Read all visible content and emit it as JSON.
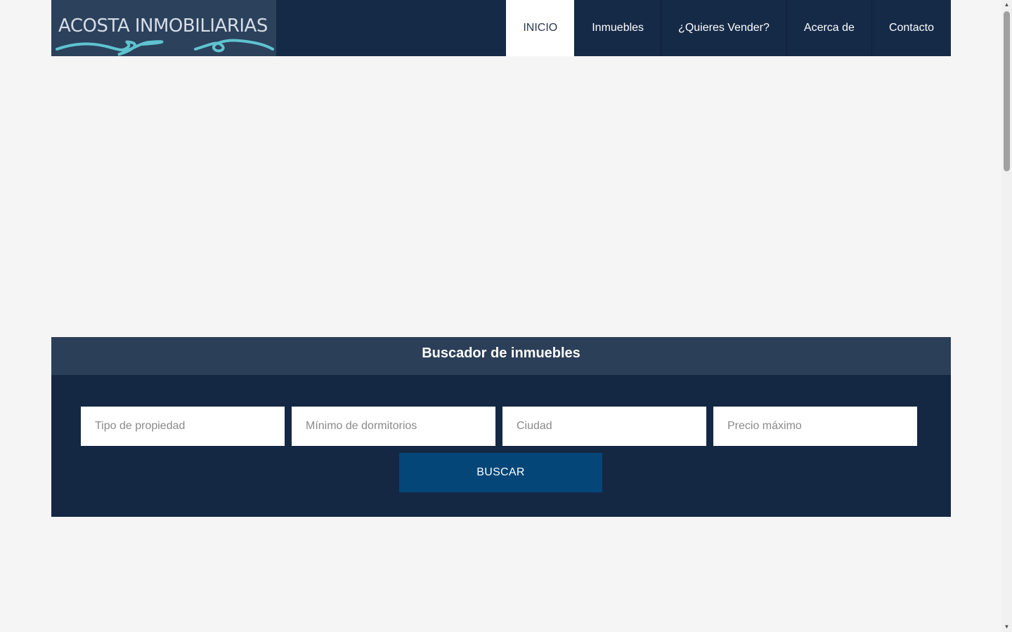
{
  "logo": {
    "text": "ACOSTA INMOBILIARIAS",
    "wave_color": "#5fc3cf"
  },
  "nav": {
    "items": [
      {
        "label": "INICIO",
        "active": true
      },
      {
        "label": "Inmuebles",
        "active": false
      },
      {
        "label": "¿Quieres Vender?",
        "active": false
      },
      {
        "label": "Acerca de",
        "active": false
      },
      {
        "label": "Contacto",
        "active": false
      }
    ]
  },
  "search": {
    "title": "Buscador de inmuebles",
    "fields": {
      "property_type": {
        "placeholder": "Tipo de propiedad",
        "value": ""
      },
      "min_bedrooms": {
        "placeholder": "Mínimo de dormitorios",
        "value": ""
      },
      "city": {
        "placeholder": "Ciudad",
        "value": ""
      },
      "max_price": {
        "placeholder": "Precio máximo",
        "value": ""
      }
    },
    "button_label": "BUSCAR"
  },
  "colors": {
    "header_bg": "#152a47",
    "search_header_bg": "#2c3f59",
    "search_body_bg": "#142844",
    "button_bg": "#034677",
    "page_bg": "#f5f5f5"
  },
  "icons": {
    "scroll_up": "triangle-up",
    "scroll_down": "triangle-down"
  }
}
